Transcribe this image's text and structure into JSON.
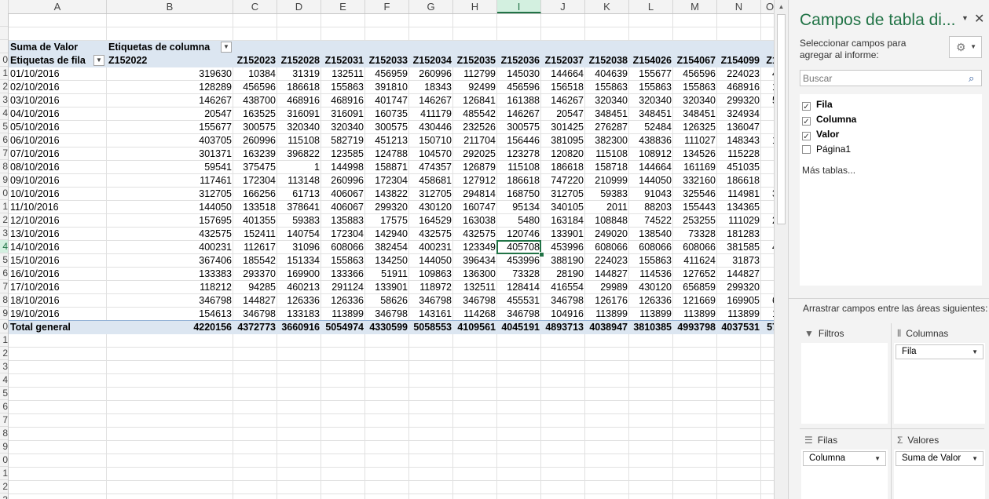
{
  "columns": [
    {
      "letter": "A",
      "w": 125
    },
    {
      "letter": "B",
      "w": 161
    },
    {
      "letter": "C",
      "w": 56
    },
    {
      "letter": "D",
      "w": 56
    },
    {
      "letter": "E",
      "w": 56
    },
    {
      "letter": "F",
      "w": 56
    },
    {
      "letter": "G",
      "w": 56
    },
    {
      "letter": "H",
      "w": 56
    },
    {
      "letter": "I",
      "w": 56
    },
    {
      "letter": "J",
      "w": 56
    },
    {
      "letter": "K",
      "w": 56
    },
    {
      "letter": "L",
      "w": 56
    },
    {
      "letter": "M",
      "w": 56
    },
    {
      "letter": "N",
      "w": 56
    },
    {
      "letter": "O",
      "w": 23
    }
  ],
  "selected_column": "I",
  "row_header_digits": [
    "",
    "",
    "",
    "0",
    "1",
    "2",
    "3",
    "4",
    "5",
    "6",
    "7",
    "8",
    "9",
    "0",
    "1",
    "2",
    "3",
    "4",
    "5",
    "6",
    "7",
    "8",
    "9",
    "0",
    "1",
    "2",
    "3",
    "4",
    "5",
    "6",
    "7",
    "8",
    "9",
    "0",
    "1",
    "2",
    "3"
  ],
  "selected_row_digit_index": 17,
  "pivot": {
    "value_label": "Suma de Valor",
    "col_labels_caption": "Etiquetas de columna",
    "row_labels_caption": "Etiquetas de fila",
    "col_keys": [
      "Z152022",
      "Z152023",
      "Z152028",
      "Z152031",
      "Z152033",
      "Z152034",
      "Z152035",
      "Z152036",
      "Z152037",
      "Z152038",
      "Z154026",
      "Z154067",
      "Z154099",
      "Z1"
    ],
    "rows": [
      {
        "label": "01/10/2016",
        "v": [
          "319630",
          "10384",
          "31319",
          "132511",
          "456959",
          "260996",
          "112799",
          "145030",
          "144664",
          "404639",
          "155677",
          "456596",
          "224023",
          "4"
        ]
      },
      {
        "label": "02/10/2016",
        "v": [
          "128289",
          "456596",
          "186618",
          "155863",
          "391810",
          "18343",
          "92499",
          "456596",
          "156518",
          "155863",
          "155863",
          "155863",
          "468916",
          "1"
        ]
      },
      {
        "label": "03/10/2016",
        "v": [
          "146267",
          "438700",
          "468916",
          "468916",
          "401747",
          "146267",
          "126841",
          "161388",
          "146267",
          "320340",
          "320340",
          "320340",
          "299320",
          "5"
        ]
      },
      {
        "label": "04/10/2016",
        "v": [
          "20547",
          "163525",
          "316091",
          "316091",
          "160735",
          "411179",
          "485542",
          "146267",
          "20547",
          "348451",
          "348451",
          "348451",
          "324934",
          ""
        ]
      },
      {
        "label": "05/10/2016",
        "v": [
          "155677",
          "300575",
          "320340",
          "320340",
          "300575",
          "430446",
          "232526",
          "300575",
          "301425",
          "276287",
          "52484",
          "126325",
          "136047",
          ""
        ]
      },
      {
        "label": "06/10/2016",
        "v": [
          "403705",
          "260996",
          "115108",
          "582719",
          "451213",
          "150710",
          "211704",
          "156446",
          "381095",
          "382300",
          "438836",
          "111027",
          "148343",
          "1"
        ]
      },
      {
        "label": "07/10/2016",
        "v": [
          "301371",
          "163239",
          "396822",
          "123585",
          "124788",
          "104570",
          "292025",
          "123278",
          "120820",
          "115108",
          "108912",
          "134526",
          "115228",
          ""
        ]
      },
      {
        "label": "08/10/2016",
        "v": [
          "59541",
          "375475",
          "1",
          "144998",
          "158871",
          "474357",
          "126879",
          "115108",
          "186618",
          "158718",
          "144664",
          "161169",
          "451035",
          ""
        ]
      },
      {
        "label": "09/10/2016",
        "v": [
          "117461",
          "172304",
          "113148",
          "260996",
          "172304",
          "458681",
          "127912",
          "186618",
          "747220",
          "210999",
          "144050",
          "332160",
          "186618",
          ""
        ]
      },
      {
        "label": "10/10/2016",
        "v": [
          "312705",
          "166256",
          "61713",
          "406067",
          "143822",
          "312705",
          "294814",
          "168750",
          "312705",
          "59383",
          "91043",
          "325546",
          "114981",
          "3"
        ]
      },
      {
        "label": "11/10/2016",
        "v": [
          "144050",
          "133518",
          "378641",
          "406067",
          "299320",
          "430120",
          "160747",
          "95134",
          "340105",
          "2011",
          "88203",
          "155443",
          "134365",
          ""
        ]
      },
      {
        "label": "12/10/2016",
        "v": [
          "157695",
          "401355",
          "59383",
          "135883",
          "17575",
          "164529",
          "163038",
          "5480",
          "163184",
          "108848",
          "74522",
          "253255",
          "111029",
          "2"
        ]
      },
      {
        "label": "13/10/2016",
        "v": [
          "432575",
          "152411",
          "140754",
          "172304",
          "142940",
          "432575",
          "432575",
          "120746",
          "133901",
          "249020",
          "138540",
          "73328",
          "181283",
          ""
        ]
      },
      {
        "label": "14/10/2016",
        "v": [
          "400231",
          "112617",
          "31096",
          "608066",
          "382454",
          "400231",
          "123349",
          "405708",
          "453996",
          "608066",
          "608066",
          "608066",
          "381585",
          "4"
        ]
      },
      {
        "label": "15/10/2016",
        "v": [
          "367406",
          "185542",
          "151334",
          "155863",
          "134250",
          "144050",
          "396434",
          "453996",
          "388190",
          "224023",
          "155863",
          "411624",
          "31873",
          ""
        ]
      },
      {
        "label": "16/10/2016",
        "v": [
          "133383",
          "293370",
          "169900",
          "133366",
          "51911",
          "109863",
          "136300",
          "73328",
          "28190",
          "144827",
          "114536",
          "127652",
          "144827",
          ""
        ]
      },
      {
        "label": "17/10/2016",
        "v": [
          "118212",
          "94285",
          "460213",
          "291124",
          "133901",
          "118972",
          "132511",
          "128414",
          "416554",
          "29989",
          "430120",
          "656859",
          "299320",
          ""
        ]
      },
      {
        "label": "18/10/2016",
        "v": [
          "346798",
          "144827",
          "126336",
          "126336",
          "58626",
          "346798",
          "346798",
          "455531",
          "346798",
          "126176",
          "126336",
          "121669",
          "169905",
          "6"
        ]
      },
      {
        "label": "19/10/2016",
        "v": [
          "154613",
          "346798",
          "133183",
          "113899",
          "346798",
          "143161",
          "114268",
          "346798",
          "104916",
          "113899",
          "113899",
          "113899",
          "113899",
          "1"
        ]
      }
    ],
    "total_label": "Total general",
    "totals": [
      "4220156",
      "4372773",
      "3660916",
      "5054974",
      "4330599",
      "5058553",
      "4109561",
      "4045191",
      "4893713",
      "4038947",
      "3810385",
      "4993798",
      "4037531",
      "57"
    ]
  },
  "pane": {
    "title": "Campos de tabla di...",
    "instruction": "Seleccionar campos para agregar al informe:",
    "search_placeholder": "Buscar",
    "fields": [
      {
        "label": "Fila",
        "checked": true
      },
      {
        "label": "Columna",
        "checked": true
      },
      {
        "label": "Valor",
        "checked": true
      },
      {
        "label": "Página1",
        "checked": false
      }
    ],
    "more_tables": "Más tablas...",
    "areas_instruction": "Arrastrar campos entre las áreas siguientes:",
    "filters_label": "Filtros",
    "columns_label": "Columnas",
    "rows_label": "Filas",
    "values_label": "Valores",
    "columns_field": "Fila",
    "rows_field": "Columna",
    "values_field": "Suma de Valor"
  }
}
